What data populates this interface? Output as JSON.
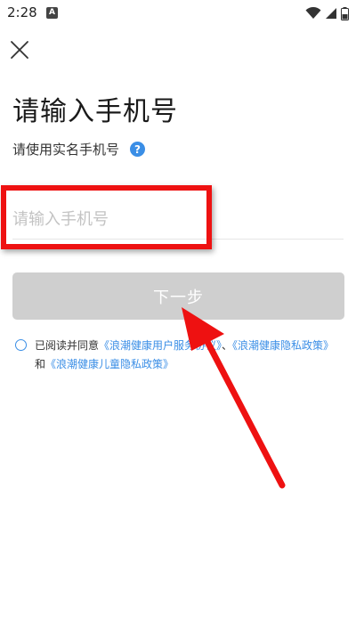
{
  "status_bar": {
    "time": "2:28",
    "a_badge": "A"
  },
  "header": {
    "close_icon": "close-icon"
  },
  "title": "请输入手机号",
  "subtitle": "请使用实名手机号",
  "help_icon_glyph": "?",
  "phone_input": {
    "placeholder": "请输入手机号",
    "value": ""
  },
  "next_button": {
    "label": "下一步"
  },
  "agreement": {
    "prefix": "已阅读并同意",
    "link1": "《浪潮健康用户服务协议》",
    "sep1": "、",
    "link2": "《浪潮健康隐私政策》",
    "sep2": "和",
    "link3": "《浪潮健康儿童隐私政策》"
  },
  "colors": {
    "accent": "#3a8ee6",
    "button_disabled": "#cfcfcf",
    "annotation": "#ee1111"
  }
}
